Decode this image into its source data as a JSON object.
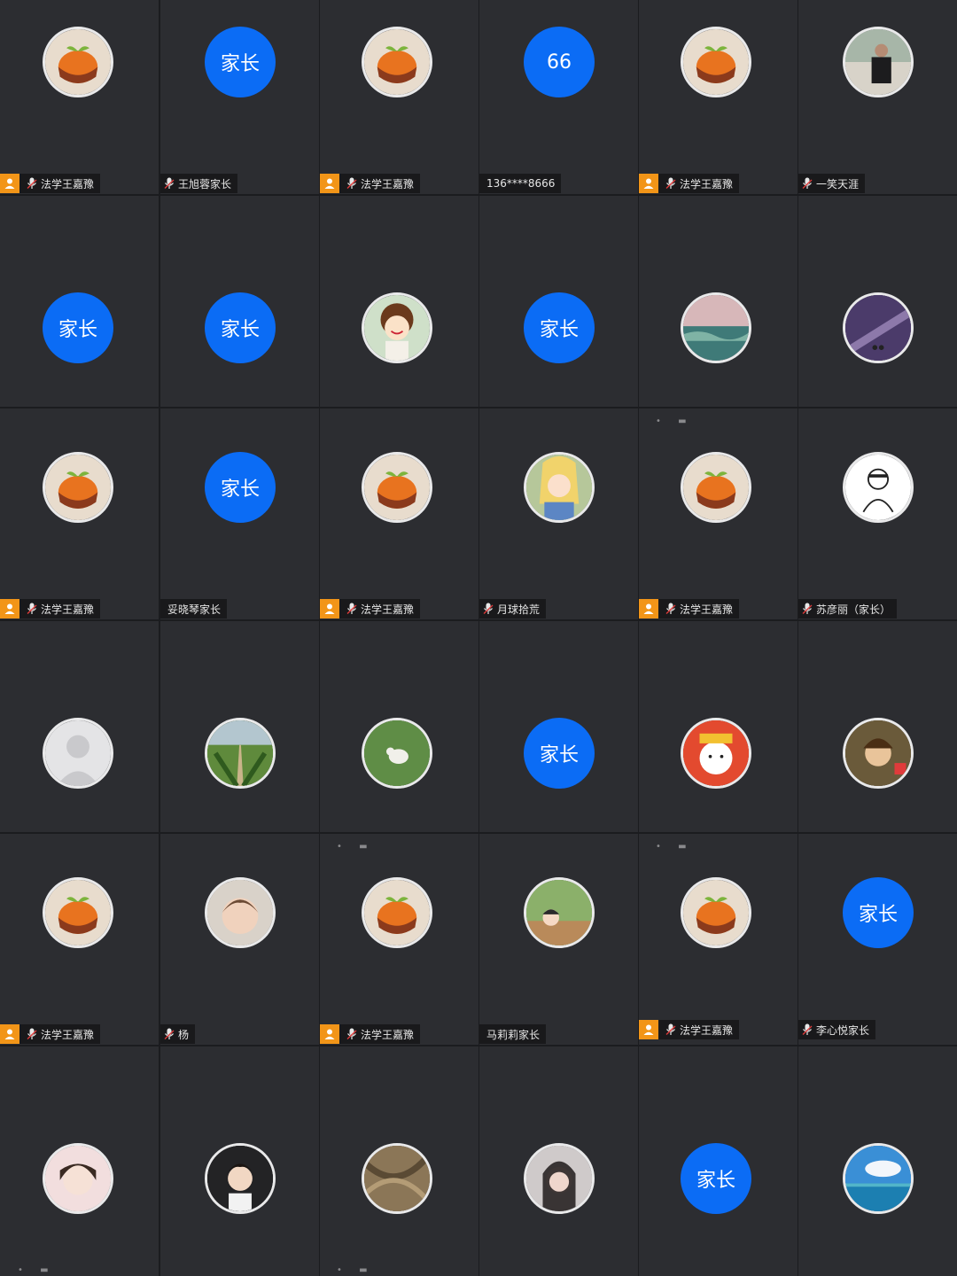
{
  "screen": {
    "title": ""
  },
  "colors": {
    "tile_bg": "#2c2d31",
    "grid_line": "#1b1c1f",
    "avatar_blue": "#0b6cf5",
    "host_badge": "#f29518"
  },
  "tiles": [
    {
      "avatar": {
        "type": "orange"
      },
      "label": {
        "name": "法学王嘉豫",
        "host": true,
        "mic": true
      }
    },
    {
      "avatar": {
        "type": "text",
        "text": "家长"
      },
      "label": {
        "name": "王旭蓉家长",
        "host": false,
        "mic": true
      }
    },
    {
      "avatar": {
        "type": "orange"
      },
      "label": {
        "name": "法学王嘉豫",
        "host": true,
        "mic": true
      }
    },
    {
      "avatar": {
        "type": "text",
        "text": "66"
      },
      "label": {
        "name": "136****8666",
        "host": false,
        "mic": false
      }
    },
    {
      "avatar": {
        "type": "orange"
      },
      "label": {
        "name": "法学王嘉豫",
        "host": true,
        "mic": true
      }
    },
    {
      "avatar": {
        "type": "man-photo"
      },
      "label": {
        "name": "一笑天涯",
        "host": false,
        "mic": true
      }
    },
    {
      "avatar": {
        "type": "text",
        "text": "家长"
      },
      "label": null
    },
    {
      "avatar": {
        "type": "text",
        "text": "家长"
      },
      "label": null
    },
    {
      "avatar": {
        "type": "cartoon-mom"
      },
      "label": null
    },
    {
      "avatar": {
        "type": "text",
        "text": "家长"
      },
      "label": null
    },
    {
      "avatar": {
        "type": "seascape"
      },
      "label": null
    },
    {
      "avatar": {
        "type": "galaxy"
      },
      "label": null
    },
    {
      "avatar": {
        "type": "orange"
      },
      "label": {
        "name": "法学王嘉豫",
        "host": true,
        "mic": true
      }
    },
    {
      "avatar": {
        "type": "text",
        "text": "家长"
      },
      "label": {
        "name": "妥晓琴家长",
        "host": false,
        "mic": false
      }
    },
    {
      "avatar": {
        "type": "orange"
      },
      "label": {
        "name": "法学王嘉豫",
        "host": true,
        "mic": true
      }
    },
    {
      "avatar": {
        "type": "anime-girl"
      },
      "label": {
        "name": "月球拾荒",
        "host": false,
        "mic": true
      }
    },
    {
      "avatar": {
        "type": "orange"
      },
      "label": {
        "name": "法学王嘉豫",
        "host": true,
        "mic": true
      }
    },
    {
      "avatar": {
        "type": "line-drawing"
      },
      "label": {
        "name": "苏彦丽（家长）",
        "host": false,
        "mic": true
      }
    },
    {
      "avatar": {
        "type": "default-user"
      },
      "label": null
    },
    {
      "avatar": {
        "type": "tree-road"
      },
      "label": null
    },
    {
      "avatar": {
        "type": "lamb-grass"
      },
      "label": null
    },
    {
      "avatar": {
        "type": "text",
        "text": "家长"
      },
      "label": null
    },
    {
      "avatar": {
        "type": "cat-sticker"
      },
      "label": null
    },
    {
      "avatar": {
        "type": "boy-cartoon"
      },
      "label": null
    },
    {
      "avatar": {
        "type": "orange"
      },
      "label": {
        "name": "法学王嘉豫",
        "host": true,
        "mic": true
      }
    },
    {
      "avatar": {
        "type": "child-photo"
      },
      "label": {
        "name": "杨",
        "host": false,
        "mic": true
      }
    },
    {
      "avatar": {
        "type": "orange"
      },
      "label": {
        "name": "法学王嘉豫",
        "host": true,
        "mic": true
      }
    },
    {
      "avatar": {
        "type": "maruko"
      },
      "label": {
        "name": "马莉莉家长",
        "host": false,
        "mic": false
      }
    },
    {
      "avatar": {
        "type": "orange"
      },
      "label": {
        "name": "法学王嘉豫",
        "host": true,
        "mic": true
      }
    },
    {
      "avatar": {
        "type": "text",
        "text": "家长"
      },
      "label": {
        "name": "李心悦家长",
        "host": false,
        "mic": true
      }
    },
    {
      "avatar": {
        "type": "girl-photo"
      },
      "label": null
    },
    {
      "avatar": {
        "type": "boy-illustration"
      },
      "label": null
    },
    {
      "avatar": {
        "type": "texture"
      },
      "label": null
    },
    {
      "avatar": {
        "type": "woman-photo"
      },
      "label": null
    },
    {
      "avatar": {
        "type": "text",
        "text": "家长"
      },
      "label": null
    },
    {
      "avatar": {
        "type": "ocean-sky"
      },
      "label": null
    }
  ]
}
